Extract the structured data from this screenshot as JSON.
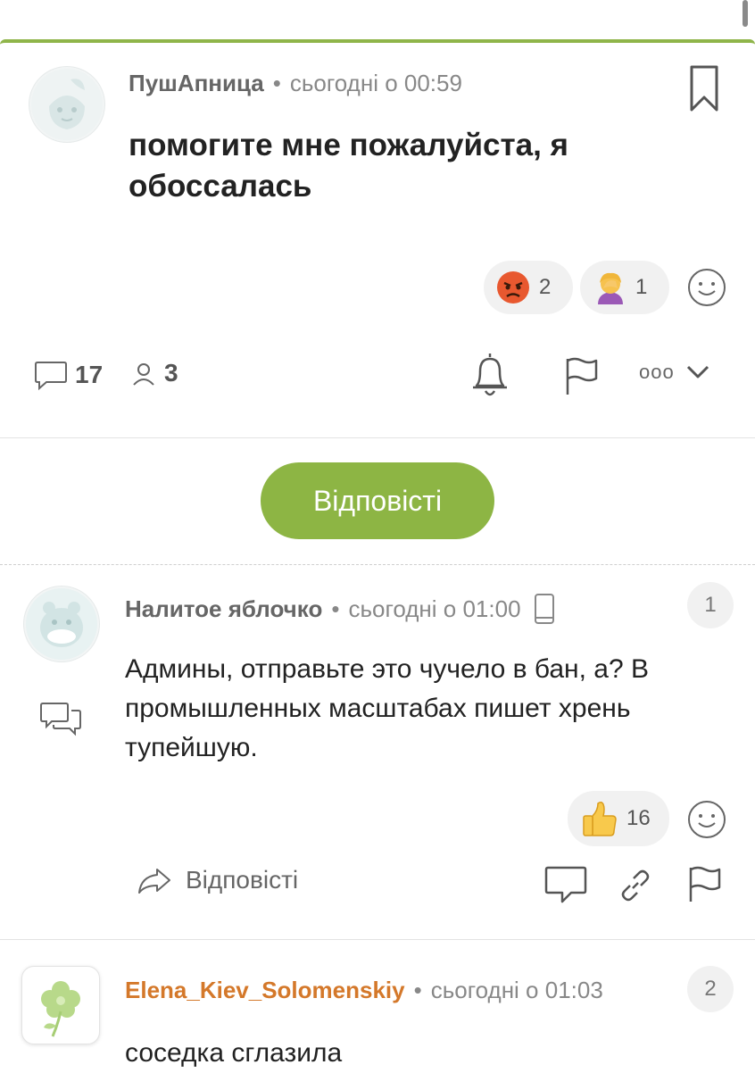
{
  "post": {
    "author": "ПушАпница",
    "time": "сьогодні о 00:59",
    "title": "помогите мне пожалуйста, я обоссалась",
    "reactions": [
      {
        "icon": "angry-face-emoji",
        "count": "2"
      },
      {
        "icon": "facepalm-woman-emoji",
        "count": "1"
      }
    ],
    "comments_count": "17",
    "participants_count": "3",
    "more_label": "ooo"
  },
  "reply_button": {
    "label": "Відповісті"
  },
  "comments": [
    {
      "number": "1",
      "author": "Налитое яблочко",
      "time": "сьогодні о 01:00",
      "text": "Админы, отправьте это чучело в бан, а? В промышленных масштабах пишет хрень тупейшую.",
      "reaction": {
        "icon": "thumbs-up-emoji",
        "count": "16"
      },
      "reply_label": "Відповісті"
    },
    {
      "number": "2",
      "author": "Elena_Kiev_Solomenskiy",
      "time": "сьогодні о 01:03",
      "text": "соседка сглазила"
    }
  ],
  "colors": {
    "accent": "#8db544",
    "author_highlight": "#d4782a"
  }
}
